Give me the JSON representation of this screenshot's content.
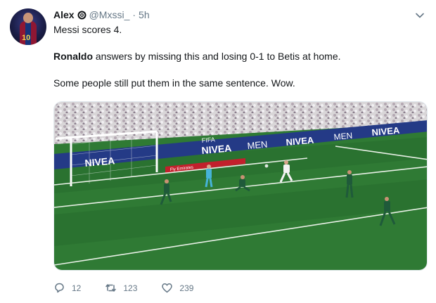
{
  "author": {
    "name": "Alex",
    "handle": "@Mxssi_",
    "separator": "·",
    "time": "5h",
    "avatar_number": "10"
  },
  "tweet": {
    "line1": "Messi scores 4.",
    "line2_bold": "Ronaldo",
    "line2_rest": " answers by missing this and losing 0-1 to Betis at home.",
    "line3": "Some people still put them in the same sentence. Wow."
  },
  "media": {
    "board_text_1": "NIVEA",
    "board_text_2": "MEN",
    "board_text_3": "Fly Emirates",
    "board_text_4": "FIFA",
    "pitch_color": "#2f7a34",
    "board_color": "#243a86"
  },
  "actions": {
    "reply_count": "12",
    "retweet_count": "123",
    "like_count": "239"
  },
  "icons": {
    "reply": "reply-icon",
    "retweet": "retweet-icon",
    "like": "like-icon",
    "caret": "chevron-down-icon",
    "badge": "translator-badge-icon"
  }
}
